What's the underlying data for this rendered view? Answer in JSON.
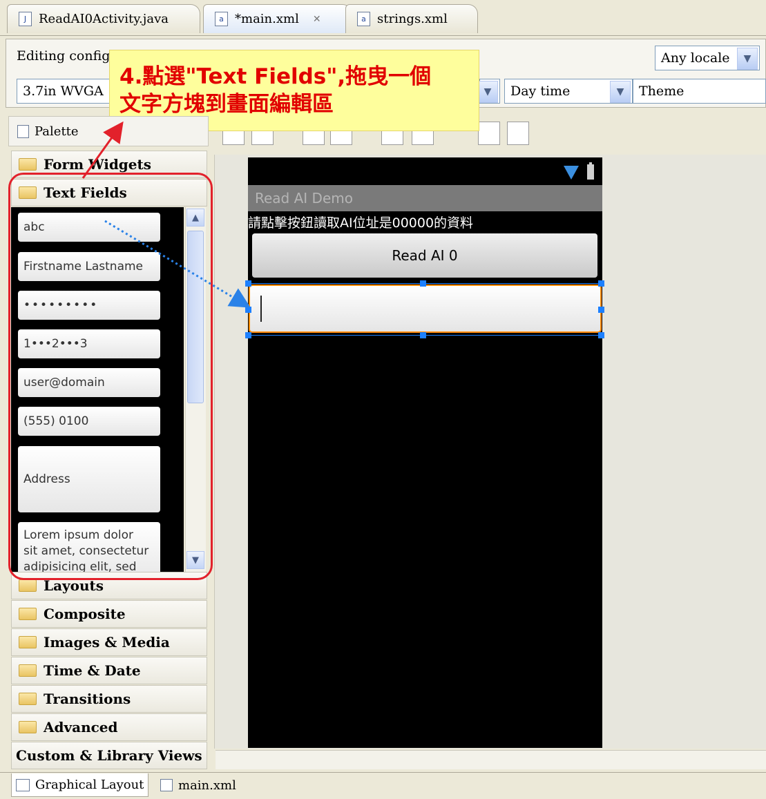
{
  "editor_tabs": [
    {
      "label": "ReadAI0Activity.java",
      "icon": "java-file-icon",
      "glyph": "J"
    },
    {
      "label": "*main.xml",
      "icon": "xml-file-icon",
      "glyph": "a"
    },
    {
      "label": "strings.xml",
      "icon": "xml-file-icon",
      "glyph": "a"
    }
  ],
  "tab_close_glyph": "✕",
  "config": {
    "editing_label": "Editing config:",
    "device_value": "3.7in WVGA",
    "locale_value": "Any locale",
    "time_value": "Day time",
    "theme_value": "Theme"
  },
  "callout": {
    "line1": "4.點選\"Text Fields\",拖曳一個",
    "line2": "文字方塊到畫面編輯區"
  },
  "palette": {
    "title": "Palette",
    "categories_top": [
      "Form Widgets",
      "Text Fields"
    ],
    "text_fields": [
      "abc",
      "Firstname Lastname",
      "•••••••••",
      "1•••2•••3",
      "user@domain",
      "(555) 0100",
      "Address",
      "Lorem ipsum dolor\nsit amet, consectetur\nadipisicing elit, sed"
    ],
    "categories_bottom": [
      "Layouts",
      "Composite",
      "Images & Media",
      "Time & Date",
      "Transitions",
      "Advanced",
      "Custom & Library Views"
    ]
  },
  "device": {
    "app_title": "Read AI Demo",
    "prompt_text": "請點擊按鈕讀取AI位址是00000的資料",
    "read_button": "Read AI 0"
  },
  "bottom_tabs": [
    "Graphical Layout",
    "main.xml"
  ],
  "colors": {
    "callout_text": "#e10000",
    "callout_bg": "#fefe9c",
    "selection": "#1c80ff",
    "focus_border": "#ff8a00",
    "highlight_ring": "#e2212b"
  }
}
